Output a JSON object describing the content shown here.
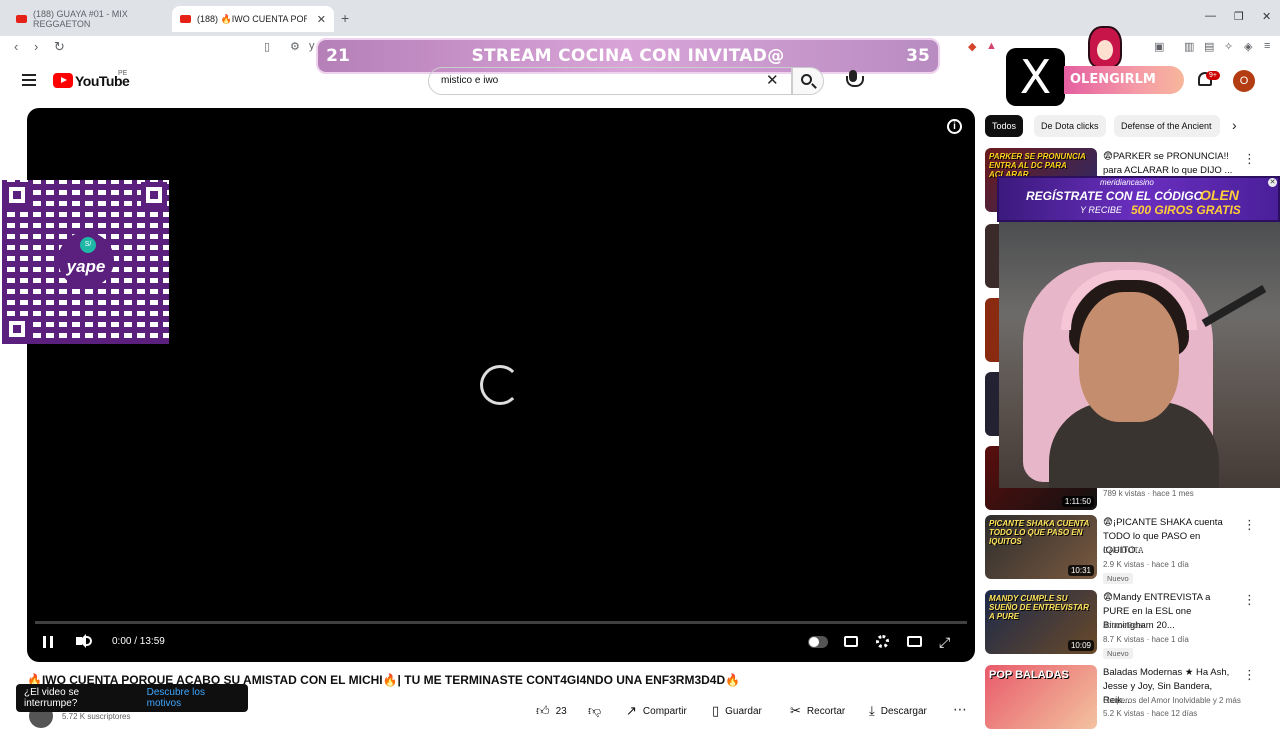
{
  "browser": {
    "tabs": [
      {
        "label": "(188) GUAYA #01 - MIX REGGAETON"
      },
      {
        "label": "(188) 🔥IWO CUENTA PORQUE A"
      }
    ],
    "address_partial": "y"
  },
  "overlay": {
    "banner_left": "21",
    "banner_text": "STREAM COCINA CON INVITAD@",
    "banner_right": "35",
    "streamer": "OLENGIRLM",
    "x_logo": "X"
  },
  "header": {
    "logo": "YouTube",
    "country": "PE",
    "search_value": "mistico e iwo",
    "notifications": "9+",
    "account_initial": "O"
  },
  "player": {
    "time": "0:00 / 13:59",
    "info": "i",
    "progress": 0
  },
  "qr": {
    "brand": "yape",
    "badge": "S/"
  },
  "video": {
    "title": "🔥IWO CUENTA PORQUE ACABO SU AMISTAD CON EL MICHI🔥| TU ME TERMINASTE CONT4GI4NDO UNA ENF3RM3D4D🔥",
    "subscribers": "5.72 K suscriptores",
    "likes": "23",
    "actions": {
      "share": "Compartir",
      "save": "Guardar",
      "clip": "Recortar",
      "download": "Descargar"
    }
  },
  "toast": {
    "text": "¿El video se interrumpe?",
    "link": "Descubre los motivos"
  },
  "chips": [
    "Todos",
    "De Dota clicks",
    "Defense of the Ancient"
  ],
  "ad": {
    "brand": "meridiancasino",
    "line1": "REGÍSTRATE CON EL CÓDIGO",
    "code": "OLEN",
    "line2": "Y RECIBE",
    "giros": "500 GIROS GRATIS"
  },
  "recommendations": [
    {
      "thumb_caption": "PARKER SE PRONUNCIA ENTRA AL DC PARA ACLARAR",
      "title": "😨PARKER se PRONUNCIA!! para ACLARAR lo que DIJO ...",
      "channel": "",
      "meta": "",
      "duration": "",
      "is_new": false
    },
    {
      "thumb_caption": "",
      "title": "",
      "channel": "",
      "meta": "789 k vistas · hace 1 mes",
      "duration": "1:11:50",
      "is_new": false
    },
    {
      "thumb_caption": "PICANTE SHAKA CUENTA TODO LO QUE PASO EN IQUITOS",
      "title": "😨¡PICANTE SHAKA cuenta TODO lo que PASO en IQUITO...",
      "channel": "CAPIDOTA",
      "meta": "2.9 K vistas · hace 1 día",
      "duration": "10:31",
      "is_new": true,
      "new_label": "Nuevo"
    },
    {
      "thumb_caption": "MANDY CUMPLE SU SUEÑO DE ENTREVISTAR A PURE",
      "title": "😨Mandy ENTREVISTA a PURE en la ESL one Birmingham 20...",
      "channel": "JotaceDota",
      "meta": "8.7 K vistas · hace 1 día",
      "duration": "10:09",
      "is_new": true,
      "new_label": "Nuevo"
    },
    {
      "thumb_caption": "POP BALADAS",
      "title": "Baladas Modernas ★ Ha Ash, Jesse y Joy, Sin Bandera, Reik...",
      "channel": "Gruperos del Amor Inolvidable y 2 más",
      "meta": "5.2 K vistas · hace 12 días",
      "duration": "",
      "is_new": false
    }
  ],
  "colors": {
    "brand_red": "#ff0000",
    "banner": "#d9a5d8",
    "qr_purple": "#5b1f7e",
    "nametag": "#e55fa0"
  }
}
